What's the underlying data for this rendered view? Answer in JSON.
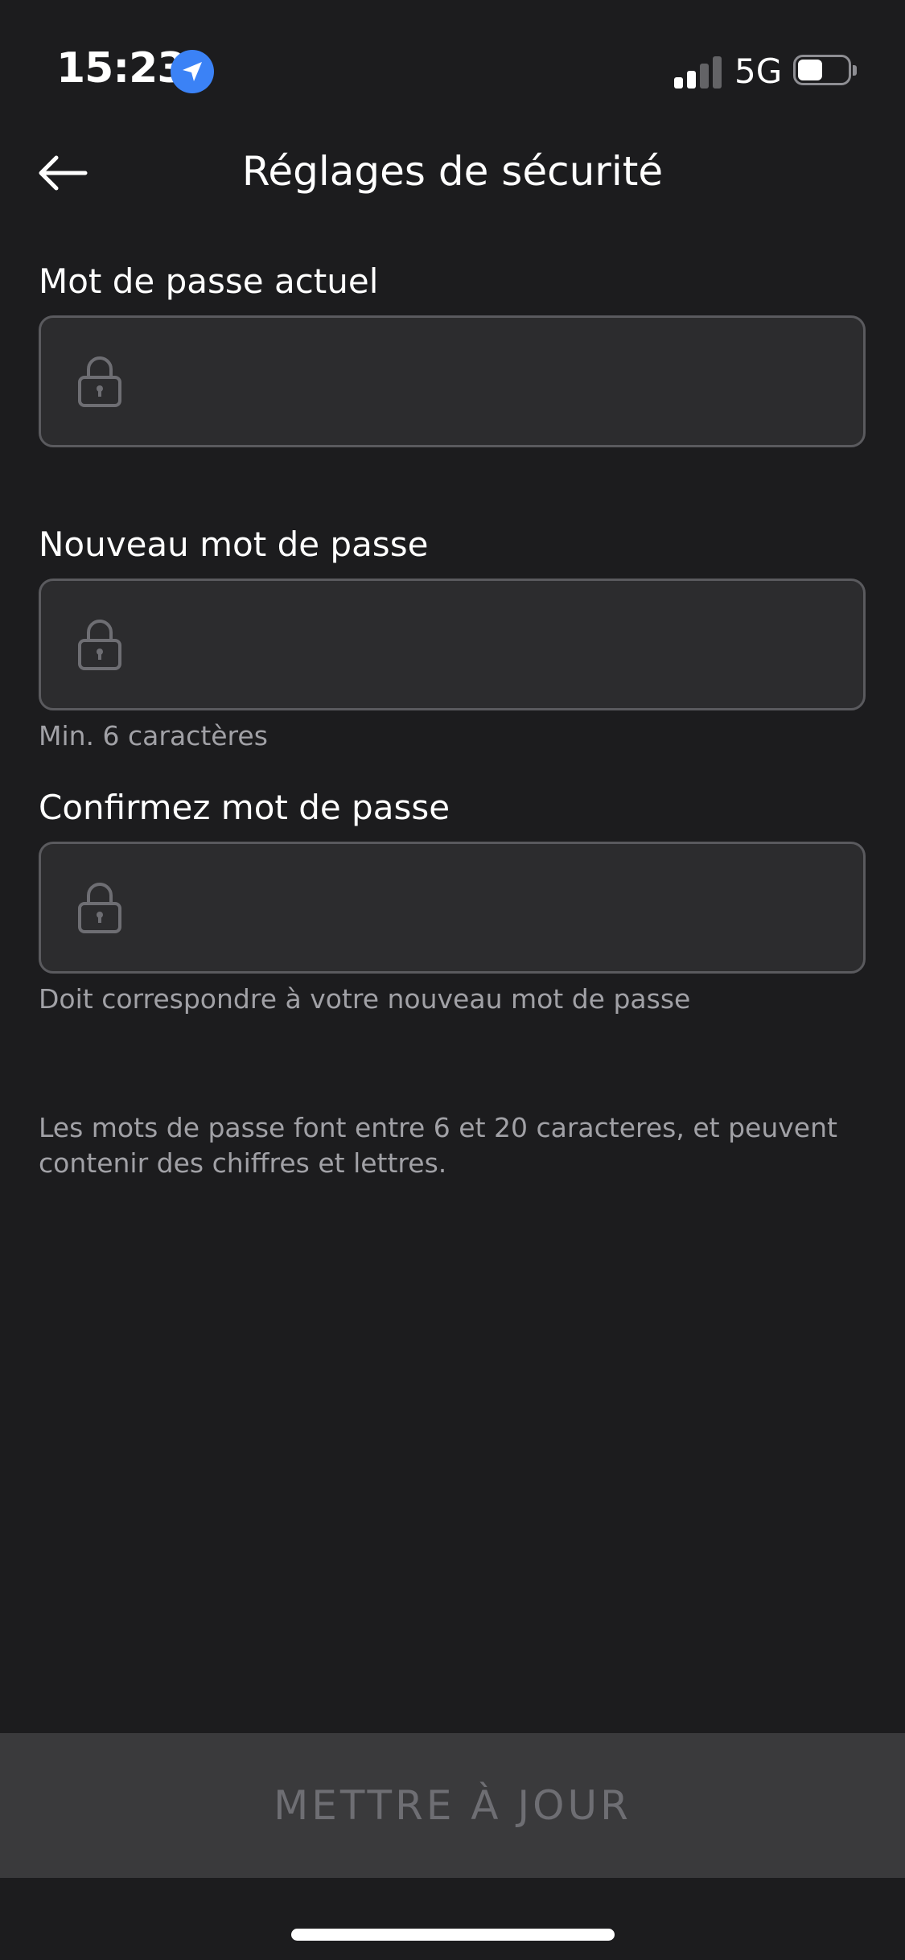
{
  "status_bar": {
    "time": "15:23",
    "network": "5G",
    "signal_strength": 2,
    "signal_max": 4,
    "battery_level": 0.5,
    "icons": [
      "location-arrow-icon",
      "cellular-signal-icon",
      "battery-icon"
    ]
  },
  "header": {
    "back_icon": "arrow-left-icon",
    "title": "Réglages de sécurité"
  },
  "form": {
    "current_password": {
      "label": "Mot de passe actuel",
      "value": "",
      "placeholder": "",
      "icon": "lock-icon"
    },
    "new_password": {
      "label": "Nouveau mot de passe",
      "value": "",
      "placeholder": "",
      "hint": "Min. 6 caractères",
      "icon": "lock-icon"
    },
    "confirm_password": {
      "label": "Confirmez mot de passe",
      "value": "",
      "placeholder": "",
      "hint": "Doit correspondre à votre nouveau mot de passe",
      "icon": "lock-icon"
    }
  },
  "info": {
    "text": "Les mots de passe font entre 6 et 20 caracteres, et peuvent contenir des chiffres et lettres."
  },
  "footer": {
    "update_label": "METTRE À JOUR"
  },
  "colors": {
    "background": "#1c1c1e",
    "input_background": "#2c2c2e",
    "input_border": "#5a5a5e",
    "hint_text": "#a1a1a6",
    "button_background": "#3a3a3c",
    "button_text_disabled": "#6e6e73",
    "location_accent": "#3b82f6"
  }
}
